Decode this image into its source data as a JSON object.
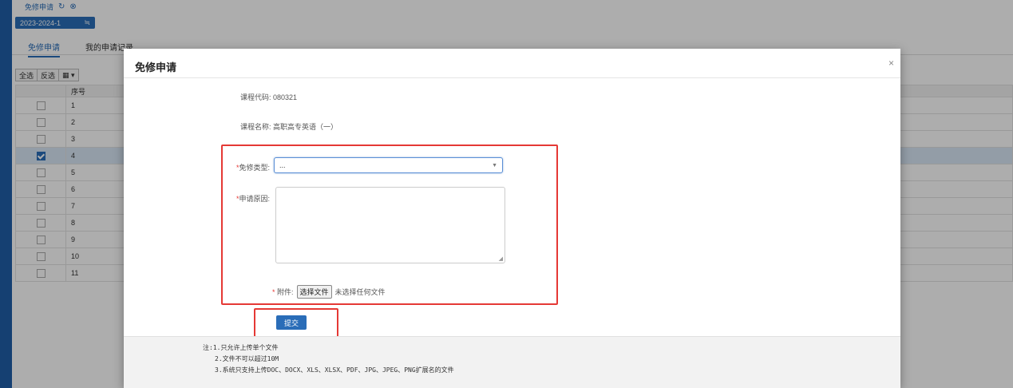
{
  "page_tab": {
    "label": "免修申请",
    "refresh_icon": "refresh-icon",
    "close_icon": "close-circle-icon"
  },
  "term_select": {
    "value": "2023-2024-1",
    "icon": "≒"
  },
  "subtabs": {
    "active": "免修申请",
    "other": "我的申请记录"
  },
  "toolbar": {
    "select_all": "全选",
    "invert": "反选",
    "columns": "▦ ▾"
  },
  "grid": {
    "header_seq": "序号",
    "rows": [
      {
        "seq": "1",
        "checked": false
      },
      {
        "seq": "2",
        "checked": false
      },
      {
        "seq": "3",
        "checked": false
      },
      {
        "seq": "4",
        "checked": true
      },
      {
        "seq": "5",
        "checked": false
      },
      {
        "seq": "6",
        "checked": false
      },
      {
        "seq": "7",
        "checked": false
      },
      {
        "seq": "8",
        "checked": false
      },
      {
        "seq": "9",
        "checked": false
      },
      {
        "seq": "10",
        "checked": false
      },
      {
        "seq": "11",
        "checked": false
      }
    ]
  },
  "modal": {
    "title": "免修申请",
    "close": "×",
    "course_code": "课程代码: 080321",
    "course_name": "课程名称: 高职高专英语（一）",
    "exempt_type_label": "免修类型:",
    "exempt_type_value": "...",
    "reason_label": "申请原因:",
    "attachment_label": "附件:",
    "file_button": "选择文件",
    "file_status": "未选择任何文件",
    "submit": "提交",
    "notes": [
      "注:1.只允许上传单个文件",
      "2.文件不可以超过10M",
      "3.系统只支持上传DOC、DOCX、XLS、XLSX、PDF、JPG、JPEG、PNG扩展名的文件"
    ],
    "highlight_color": "#e53935",
    "accent_color": "#2a6db8"
  }
}
